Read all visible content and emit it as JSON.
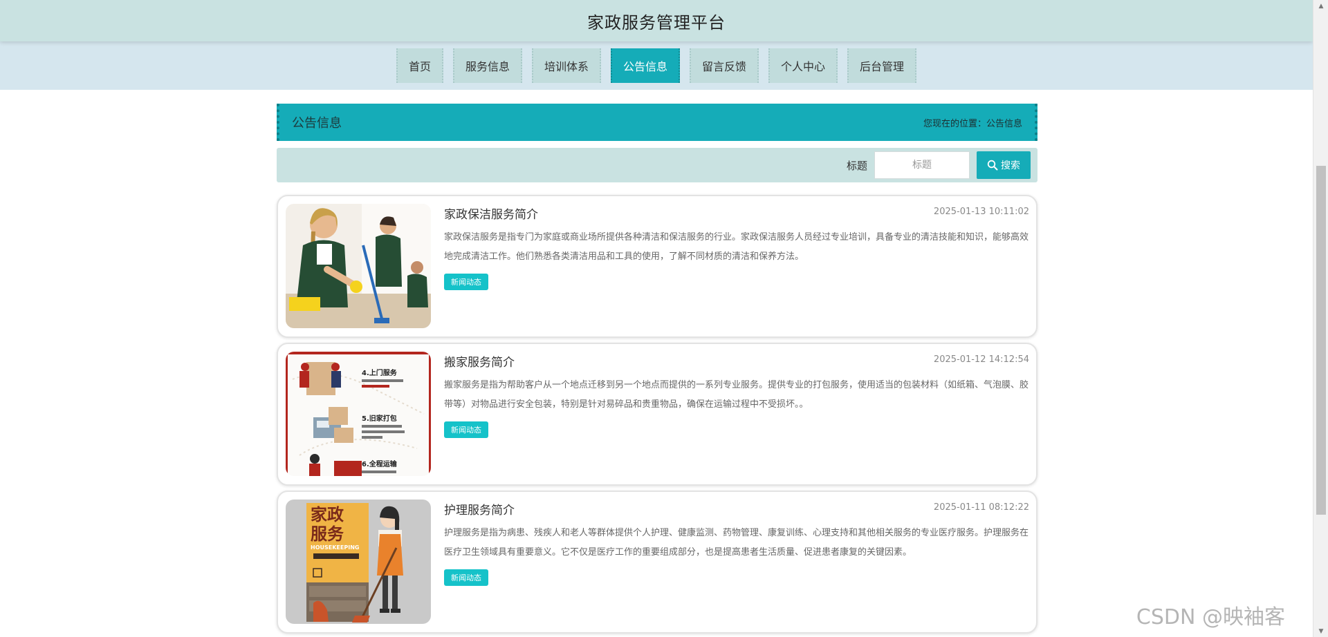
{
  "header": {
    "title": "家政服务管理平台"
  },
  "nav": {
    "items": [
      {
        "label": "首页",
        "active": false
      },
      {
        "label": "服务信息",
        "active": false
      },
      {
        "label": "培训体系",
        "active": false
      },
      {
        "label": "公告信息",
        "active": true
      },
      {
        "label": "留言反馈",
        "active": false
      },
      {
        "label": "个人中心",
        "active": false
      },
      {
        "label": "后台管理",
        "active": false
      }
    ]
  },
  "location": {
    "section_title": "公告信息",
    "crumb": "您现在的位置：公告信息"
  },
  "search": {
    "label": "标题",
    "placeholder": "标题",
    "value": "",
    "button_label": "搜索"
  },
  "announcements": [
    {
      "title": "家政保洁服务简介",
      "date": "2025-01-13 10:11:02",
      "summary": "家政保洁服务是指专门为家庭或商业场所提供各种清洁和保洁服务的行业。家政保洁服务人员经过专业培训，具备专业的清洁技能和知识，能够高效地完成清洁工作。他们熟悉各类清洁用品和工具的使用，了解不同材质的清洁和保养方法。",
      "tag": "新闻动态"
    },
    {
      "title": "搬家服务简介",
      "date": "2025-01-12 14:12:54",
      "summary": "搬家服务是指为帮助客户从一个地点迁移到另一个地点而提供的一系列专业服务。提供专业的打包服务，使用适当的包装材料（如纸箱、气泡膜、胶带等）对物品进行安全包装，特别是针对易碎品和贵重物品，确保在运输过程中不受损坏。。",
      "tag": "新闻动态",
      "thumb_text": [
        "4.上门服务",
        "5.旧家打包",
        "6.全程运输"
      ]
    },
    {
      "title": "护理服务简介",
      "date": "2025-01-11 08:12:22",
      "summary": "护理服务是指为病患、残疾人和老人等群体提供个人护理、健康监测、药物管理、康复训练、心理支持和其他相关服务的专业医疗服务。护理服务在医疗卫生领域具有重要意义。它不仅是医疗工作的重要组成部分，也是提高患者生活质量、促进患者康复的关键因素。",
      "tag": "新闻动态",
      "thumb_text": [
        "家政",
        "服务",
        "HOUSEKEEPING"
      ]
    }
  ],
  "watermark": "CSDN @映袖客",
  "colors": {
    "accent": "#15acb8",
    "header_bg": "#c9e2e1",
    "nav_bg": "#d5e6ee",
    "tag": "#15c2c9"
  }
}
